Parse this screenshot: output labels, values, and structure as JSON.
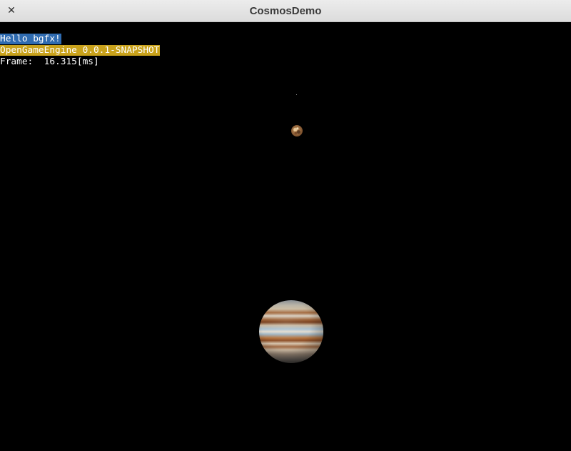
{
  "window": {
    "title": "CosmosDemo",
    "close_glyph": "✕"
  },
  "debug_text": {
    "line1": "Hello bgfx!",
    "line2": "OpenGameEngine 0.0.1-SNAPSHOT",
    "line3": "Frame:  16.315[ms]"
  },
  "colors": {
    "background": "#000000",
    "line1_highlight": "#2f6bb0",
    "line2_highlight": "#c9a21b"
  },
  "scene": {
    "objects": [
      "star",
      "moon",
      "jupiter"
    ]
  }
}
